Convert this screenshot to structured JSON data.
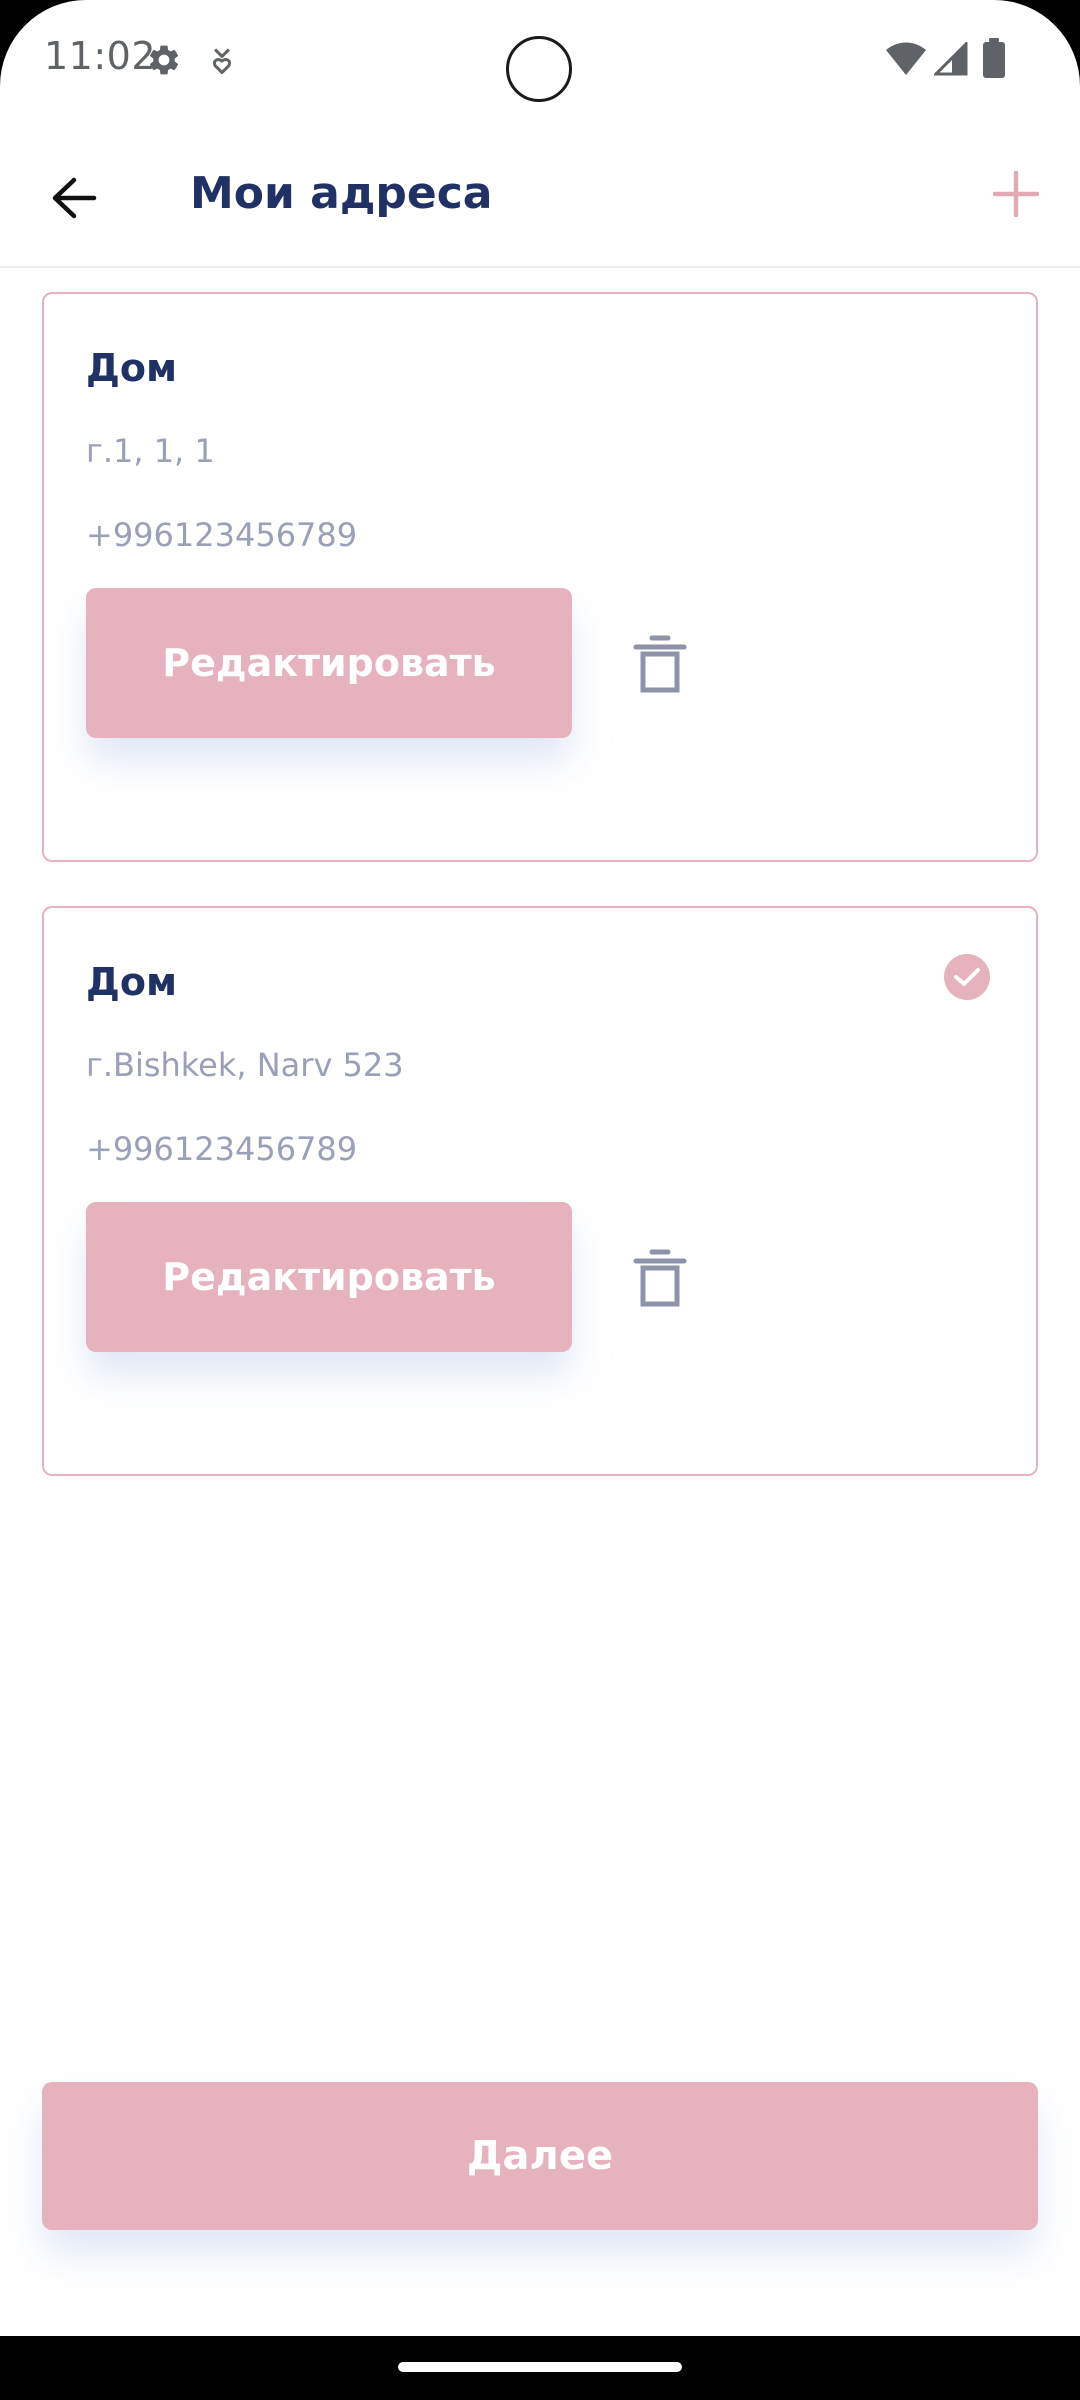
{
  "status_bar": {
    "time": "11:02",
    "icons": [
      "settings-icon",
      "download-status-icon",
      "wifi-icon",
      "cellular-signal-icon",
      "battery-icon"
    ]
  },
  "app_bar": {
    "title": "Мои адреса",
    "back_icon": "arrow-back-icon",
    "add_icon": "plus-icon"
  },
  "addresses": [
    {
      "name": "Дом",
      "address": "г.1, 1, 1",
      "phone": "+996123456789",
      "edit_label": "Редактировать",
      "selected": false
    },
    {
      "name": "Дом",
      "address": "г.Bishkek, Narv 523",
      "phone": "+996123456789",
      "edit_label": "Редактировать",
      "selected": true
    }
  ],
  "footer": {
    "next_label": "Далее"
  },
  "colors": {
    "accent": "#e5b2bd",
    "title": "#1f3165",
    "muted_text": "#9aa0b7",
    "icon_gray": "#8e93aa"
  }
}
